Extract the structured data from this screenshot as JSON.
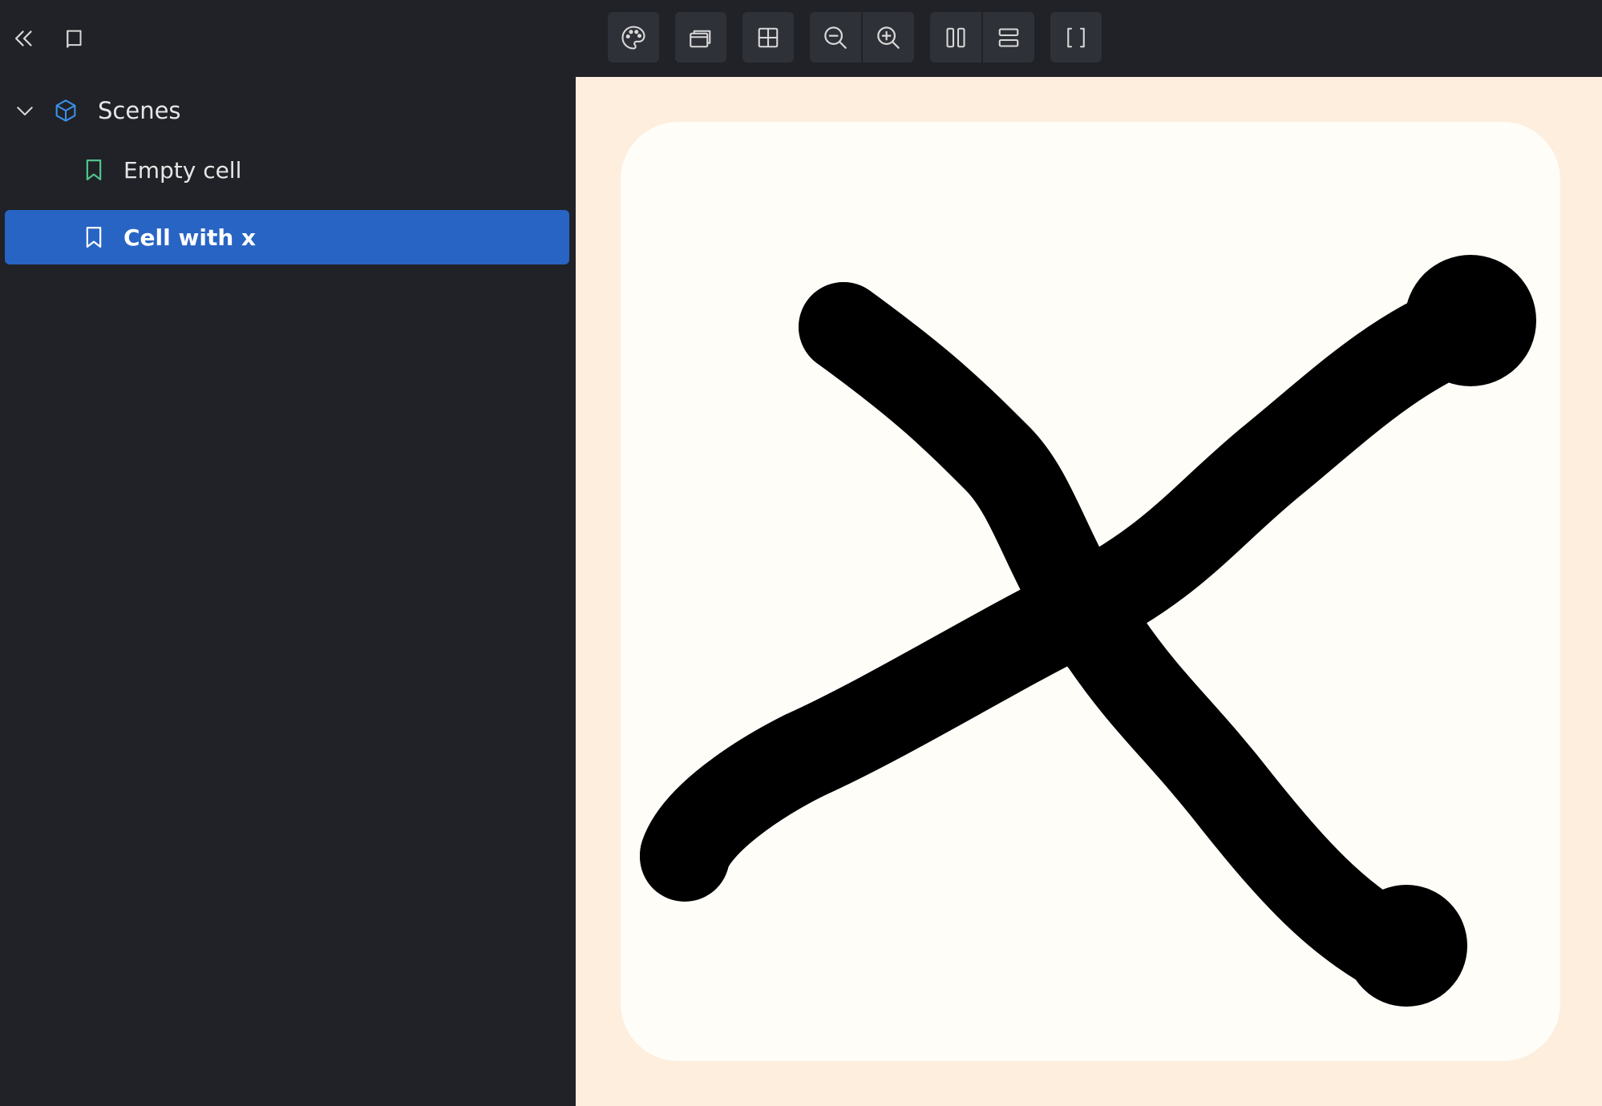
{
  "sidebar": {
    "root": {
      "label": "Scenes",
      "icon": "cube-icon",
      "expanded": true
    },
    "items": [
      {
        "label": "Empty cell",
        "icon": "bookmark-icon",
        "selected": false
      },
      {
        "label": "Cell with x",
        "icon": "bookmark-icon",
        "selected": true
      }
    ]
  },
  "toolbar": {
    "left": [
      "collapse-sidebar-icon",
      "book-icon"
    ],
    "tools": [
      "palette-icon",
      "windows-icon",
      "grid-icon",
      "zoom-out-icon",
      "zoom-in-icon",
      "split-vertical-icon",
      "split-horizontal-icon",
      "brackets-icon"
    ]
  },
  "colors": {
    "background": "#202227",
    "selection": "#2864c4",
    "canvas": "#fdeedd",
    "cell": "#fefdf8",
    "mark": "#000000",
    "cube_accent": "#3b8ee6",
    "bookmark_accent": "#4cc48a"
  },
  "canvas": {
    "content": "cell with hand-drawn x"
  }
}
